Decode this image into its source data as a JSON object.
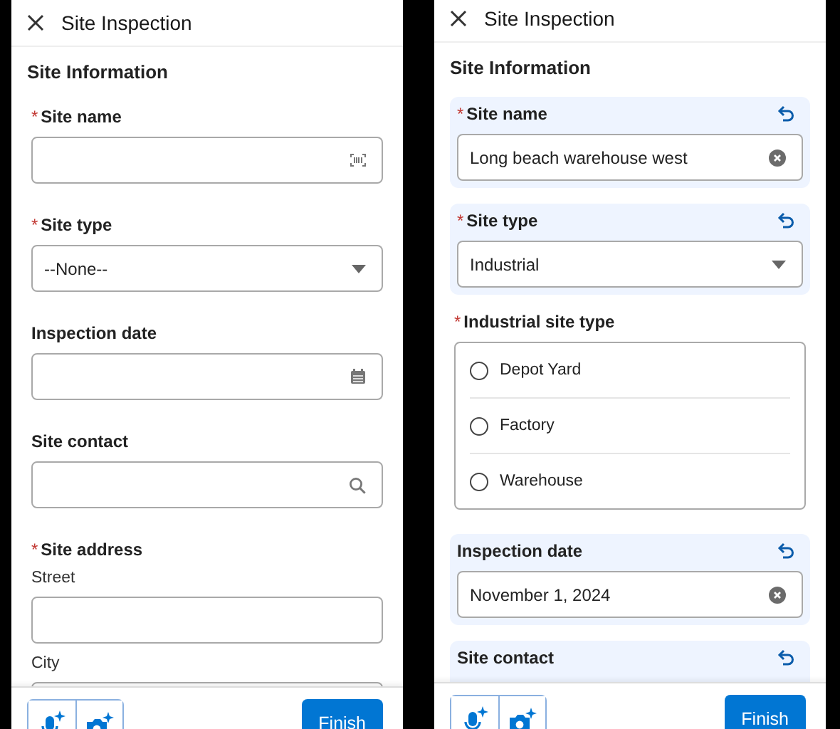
{
  "screens": [
    {
      "title": "Site Inspection",
      "section": "Site Information",
      "fields": [
        {
          "kind": "text",
          "label": "Site name",
          "required_mark": "*",
          "changed": false
        },
        {
          "kind": "picklist",
          "label": "Site type",
          "required_mark": "*",
          "changed": false,
          "value": "--None--"
        },
        {
          "kind": "date",
          "label": "Inspection date",
          "changed": false
        },
        {
          "kind": "lookup",
          "label": "Site contact",
          "changed": false
        },
        {
          "kind": "address",
          "label": "Site address",
          "required_mark": "*",
          "changed": false,
          "parts": [
            "Street",
            "City"
          ]
        }
      ],
      "footer": {
        "finish": "Finish"
      }
    },
    {
      "title": "Site Inspection",
      "section": "Site Information",
      "fields": [
        {
          "kind": "text",
          "label": "Site name",
          "required_mark": "*",
          "changed": true,
          "value": "Long beach warehouse west"
        },
        {
          "kind": "picklist",
          "label": "Site type",
          "required_mark": "*",
          "changed": true,
          "value": "Industrial"
        },
        {
          "kind": "radio",
          "label": "Industrial site type",
          "required_mark": "*",
          "changed": false,
          "options": [
            {
              "label": "Depot Yard",
              "selected": false
            },
            {
              "label": "Factory",
              "selected": false
            },
            {
              "label": "Warehouse",
              "selected": false
            }
          ]
        },
        {
          "kind": "date",
          "label": "Inspection date",
          "changed": true,
          "value": "November 1, 2024"
        },
        {
          "label": "Site contact",
          "changed": true
        }
      ],
      "footer": {
        "finish": "Finish"
      }
    }
  ]
}
